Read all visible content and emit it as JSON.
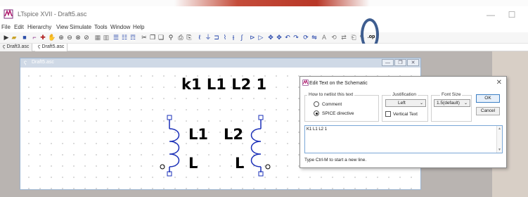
{
  "app": {
    "title": "LTspice XVII - Draft5.asc",
    "min_label": "—",
    "max_label": "☐",
    "close_label": "✕"
  },
  "menu": [
    "File",
    "Edit",
    "Hierarchy",
    "View",
    "Simulate",
    "Tools",
    "Window",
    "Help"
  ],
  "toolbar": {
    "icons": [
      "run-icon",
      "open-icon",
      "save-icon",
      "wire-icon",
      "probe-icon",
      "halt-icon",
      "zoom-in-icon",
      "zoom-out-icon",
      "zoom-fit-icon",
      "zoom-area-icon",
      "autorange-icon",
      "tile-icon",
      "cascade-icon",
      "waveform-icon",
      "cut-icon",
      "copy-icon",
      "paste-icon",
      "find-icon",
      "print-icon",
      "print-preview-icon",
      "draw-wire-icon",
      "ground-icon",
      "label-icon",
      "resistor-icon",
      "capacitor-icon",
      "inductor-icon",
      "diode-icon",
      "component-icon",
      "rotate-icon",
      "mirror-icon",
      "undo-icon",
      "redo-icon",
      "text-icon",
      "spice-directive-icon"
    ],
    "op_label": ".op"
  },
  "tabs": [
    {
      "label": "Draft3.asc"
    },
    {
      "label": "Draft5.asc"
    }
  ],
  "schematic_window": {
    "title": "Draft5.asc",
    "directive_text": "k1 L1 L2 1",
    "inductors": [
      {
        "name": "L1",
        "value": "L"
      },
      {
        "name": "L2",
        "value": "L"
      }
    ]
  },
  "dialog": {
    "title": "Edit Text on the Schematic",
    "netlist_group": "How to netlist this text",
    "option_comment": "Comment",
    "option_spice": "SPICE directive",
    "selected": "spice",
    "justification_label": "Justification",
    "justification_value": "Left",
    "vertical_text_label": "Vertical Text",
    "font_size_label": "Font Size",
    "font_size_value": "1.5(default)",
    "ok_label": "OK",
    "cancel_label": "Cancel",
    "text_value": "K1 L1 L2 1",
    "hint": "Type Ctrl-M to start a new line."
  },
  "colors": {
    "accent_oval": "#3e5d8f",
    "inductor_blue": "#1a2fb8"
  }
}
